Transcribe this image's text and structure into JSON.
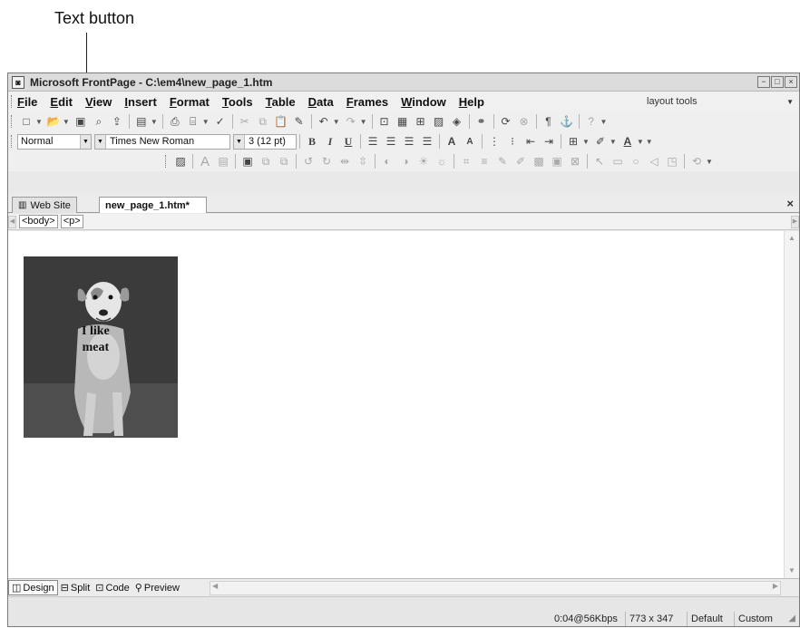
{
  "annotation": {
    "label": "Text button"
  },
  "window": {
    "title": "Microsoft FrontPage - C:\\em4\\new_page_1.htm",
    "controls": {
      "minimize": "−",
      "maximize": "□",
      "close": "×"
    }
  },
  "menubar": {
    "items": [
      "File",
      "Edit",
      "View",
      "Insert",
      "Format",
      "Tools",
      "Table",
      "Data",
      "Frames",
      "Window",
      "Help"
    ],
    "layout_tools": "layout tools"
  },
  "formatting": {
    "style": "Normal",
    "font": "Times New Roman",
    "size": "3 (12 pt)",
    "bold": "B",
    "italic": "I",
    "underline": "U",
    "grow_font": "A",
    "shrink_font": "A"
  },
  "tabs": [
    {
      "label": "Web Site"
    },
    {
      "label": "new_page_1.htm*"
    }
  ],
  "tab_close": "×",
  "tag_selector": [
    "<body>",
    "<p>"
  ],
  "page": {
    "image_caption_line1": "I like",
    "image_caption_line2": "meat"
  },
  "view_buttons": [
    {
      "label": "Design"
    },
    {
      "label": "Split"
    },
    {
      "label": "Code"
    },
    {
      "label": "Preview"
    }
  ],
  "status": {
    "download_time": "0:04@56Kbps",
    "page_size": "773 x 347",
    "mode": "Default",
    "custom": "Custom"
  }
}
